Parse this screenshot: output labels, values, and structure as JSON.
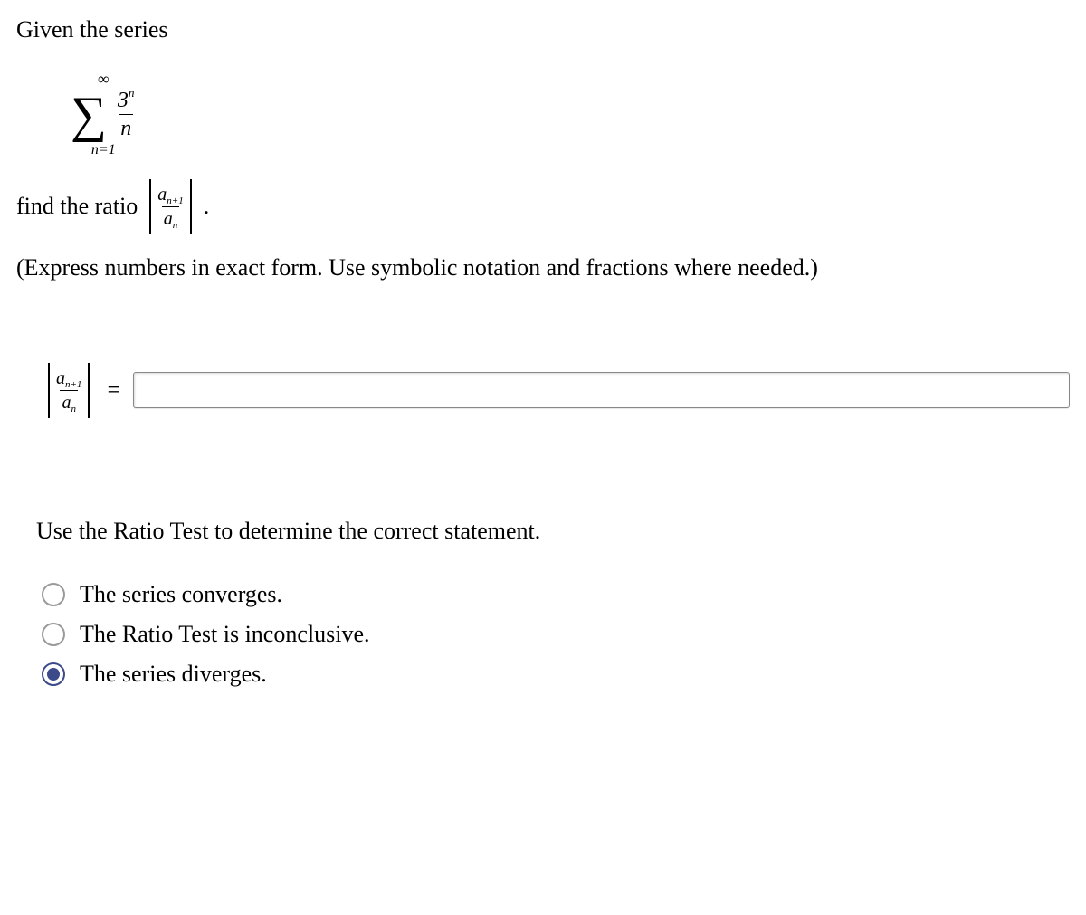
{
  "prompt_intro": "Given the series",
  "series": {
    "upper": "∞",
    "lower": "n=1",
    "numerator_base": "3",
    "numerator_exp": "n",
    "denominator": "n"
  },
  "find_ratio_text": "find the ratio",
  "ratio_symbol": {
    "a": "a",
    "nplus1": "n+1",
    "n": "n"
  },
  "period": ".",
  "instruction_text": "(Express numbers in exact form. Use symbolic notation and fractions where needed.)",
  "equals": "=",
  "answer_value": "",
  "statement_text": "Use the Ratio Test to determine the correct statement.",
  "options": [
    {
      "label": "The series converges.",
      "selected": false
    },
    {
      "label": "The Ratio Test is inconclusive.",
      "selected": false
    },
    {
      "label": "The series diverges.",
      "selected": true
    }
  ]
}
